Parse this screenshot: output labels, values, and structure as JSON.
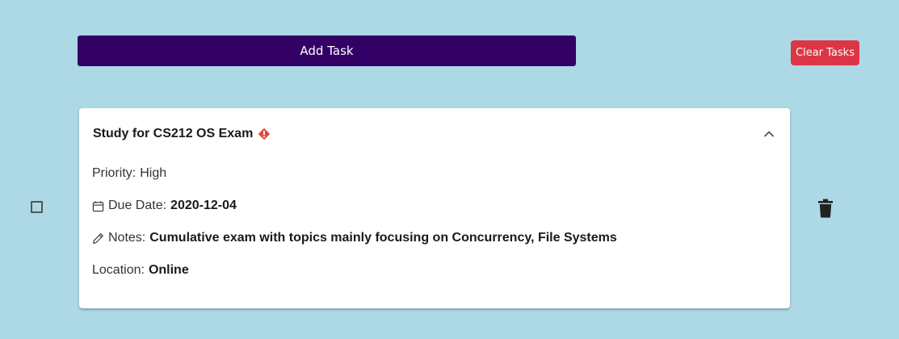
{
  "toolbar": {
    "add_task_label": "Add Task",
    "clear_tasks_label": "Clear Tasks"
  },
  "colors": {
    "background": "#add8e6",
    "add_button": "#330066",
    "clear_button": "#dc3545",
    "priority_flag": "#e04a3c"
  },
  "task": {
    "title": "Study for CS212 OS Exam",
    "completed": false,
    "expanded": true,
    "priority_label": "Priority:",
    "priority_value": "High",
    "due_label": "Due Date:",
    "due_value": "2020-12-04",
    "notes_label": "Notes:",
    "notes_value": "Cumulative exam with topics mainly focusing on Concurrency, File Systems",
    "location_label": "Location:",
    "location_value": "Online",
    "icons": {
      "priority": "exclamation-diamond-icon",
      "collapse": "chevron-up-icon",
      "due": "calendar-icon",
      "notes": "pencil-icon",
      "delete": "trash-icon"
    }
  }
}
